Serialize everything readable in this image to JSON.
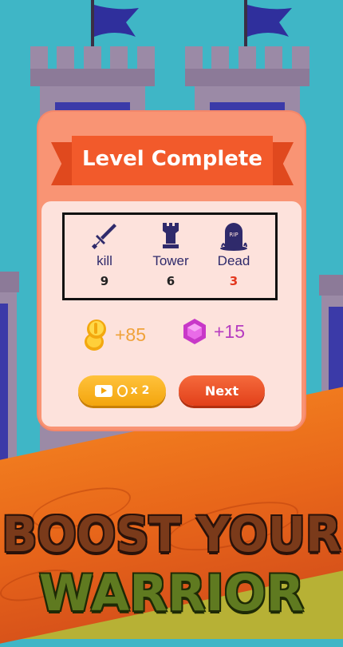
{
  "popup": {
    "title": "Level Complete",
    "stats": [
      {
        "icon": "sword-icon",
        "label": "kill",
        "value": "9"
      },
      {
        "icon": "tower-icon",
        "label": "Tower",
        "value": "6"
      },
      {
        "icon": "tombstone-icon",
        "label": "Dead",
        "value": "3",
        "tombstone_text": "RIP"
      }
    ],
    "rewards": {
      "coins": "+85",
      "gems": "+15"
    },
    "buttons": {
      "double_multiplier": "x 2",
      "next_label": "Next"
    }
  },
  "banner": {
    "line1": "BOOST YOUR",
    "line2": "WARRIOR"
  },
  "colors": {
    "sky": "#3fb6c6",
    "panel": "#f99474",
    "ribbon": "#f25a2b",
    "coin_text": "#f0a23a",
    "gem_text": "#b63cc0",
    "dead_value": "#e3371e"
  }
}
